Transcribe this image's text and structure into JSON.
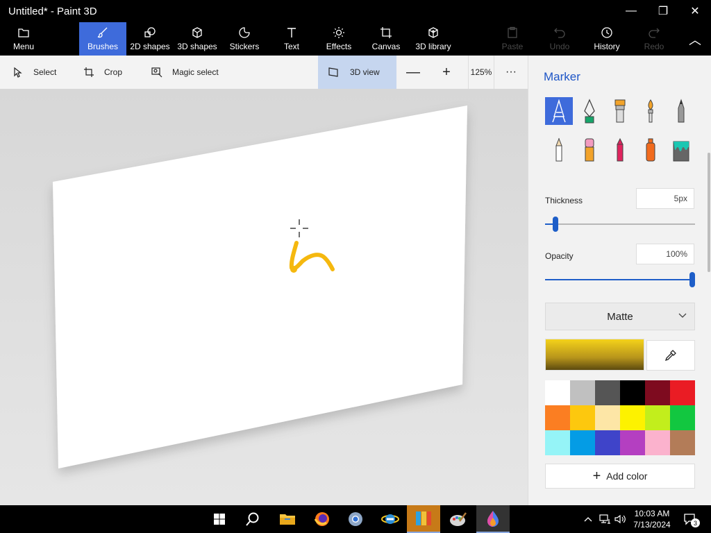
{
  "window": {
    "title": "Untitled* - Paint 3D",
    "minimize_glyph": "—",
    "restore_glyph": "❐",
    "close_glyph": "✕"
  },
  "ribbon": {
    "menu": "Menu",
    "brushes": "Brushes",
    "shapes2d": "2D shapes",
    "shapes3d": "3D shapes",
    "stickers": "Stickers",
    "text": "Text",
    "effects": "Effects",
    "canvas": "Canvas",
    "library3d": "3D library",
    "paste": "Paste",
    "undo": "Undo",
    "history": "History",
    "redo": "Redo",
    "collapse_glyph": "︿"
  },
  "toolbar": {
    "select": "Select",
    "crop": "Crop",
    "magic_select": "Magic select",
    "view3d": "3D view",
    "zoom_out": "—",
    "zoom_in": "+",
    "zoom_level": "125%",
    "more": "···"
  },
  "panel": {
    "title": "Marker",
    "brushes": [
      "marker",
      "calligraphy-pen",
      "oil-brush",
      "watercolor",
      "pixel-pen",
      "pencil",
      "eraser",
      "crayon",
      "spray-can",
      "fill"
    ],
    "thickness_label": "Thickness",
    "thickness_value": "5px",
    "thickness_level": 0.05,
    "opacity_label": "Opacity",
    "opacity_value": "100%",
    "opacity_level": 1.0,
    "finish": "Matte",
    "add_color": "Add color",
    "accent": "#1e5ec8",
    "palette": [
      "#ffffff",
      "#c0c0c0",
      "#555555",
      "#000000",
      "#7e0b1f",
      "#ea1c24",
      "#fb7e22",
      "#fdc80e",
      "#fde6a6",
      "#fdf200",
      "#c2ee1c",
      "#12c740",
      "#95f4f7",
      "#049ce5",
      "#3f44c9",
      "#b43fc1",
      "#fbb2cd",
      "#b37c58"
    ]
  },
  "canvas": {
    "stroke_color": "#f5b80f"
  },
  "taskbar": {
    "time": "10:03 AM",
    "date": "7/13/2024",
    "notifications": "3"
  }
}
